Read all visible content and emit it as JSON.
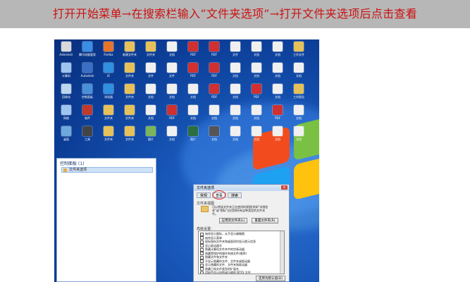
{
  "banner": {
    "text": "打开开始菜单→在搜索栏输入“文件夹选项”→打开文件夹选项后点击查看"
  },
  "desktop": {
    "icons": [
      {
        "label": "Administr",
        "color": "#d9d9d9"
      },
      {
        "label": "腾讯电脑管家",
        "color": "#3a8ee6"
      },
      {
        "label": "Firefox",
        "color": "#e8742b"
      },
      {
        "label": "新建文件夹",
        "color": "#e6c15a"
      },
      {
        "label": "文件夹",
        "color": "#e6c15a"
      },
      {
        "label": "文档",
        "color": "#f0f0f0"
      },
      {
        "label": "PDF",
        "color": "#d03030"
      },
      {
        "label": "PDF",
        "color": "#d03030"
      },
      {
        "label": "文件",
        "color": "#f0f0f0"
      },
      {
        "label": "文档",
        "color": "#f0f0f0"
      },
      {
        "label": "文档",
        "color": "#f0f0f0"
      },
      {
        "label": "工作文件",
        "color": "#e6c15a"
      },
      {
        "label": "计算机",
        "color": "#9fc5ef"
      },
      {
        "label": "Autodesk",
        "color": "#3a6fc4"
      },
      {
        "label": "IE",
        "color": "#2f8fe0"
      },
      {
        "label": "文件夹",
        "color": "#e6c15a"
      },
      {
        "label": "文件",
        "color": "#f0f0f0"
      },
      {
        "label": "文件",
        "color": "#f0f0f0"
      },
      {
        "label": "PDF",
        "color": "#d03030"
      },
      {
        "label": "PDF",
        "color": "#d03030"
      },
      {
        "label": "文档",
        "color": "#f0f0f0"
      },
      {
        "label": "文档",
        "color": "#f0f0f0"
      },
      {
        "label": "文档",
        "color": "#f0f0f0"
      },
      {
        "label": "文档",
        "color": "#f0f0f0"
      },
      {
        "label": "回收站",
        "color": "#bcd6f0"
      },
      {
        "label": "控制面板",
        "color": "#4a90d9"
      },
      {
        "label": "浏览器",
        "color": "#2f8fe0"
      },
      {
        "label": "文件夹",
        "color": "#e6c15a"
      },
      {
        "label": "文档",
        "color": "#f0f0f0"
      },
      {
        "label": "文档",
        "color": "#f0f0f0"
      },
      {
        "label": "文档",
        "color": "#f0f0f0"
      },
      {
        "label": "PDF",
        "color": "#d03030"
      },
      {
        "label": "文档",
        "color": "#f0f0f0"
      },
      {
        "label": "PDF",
        "color": "#d03030"
      },
      {
        "label": "文档",
        "color": "#f0f0f0"
      },
      {
        "label": "工作报告",
        "color": "#e6c15a"
      },
      {
        "label": "网络",
        "color": "#9fc5ef"
      },
      {
        "label": "软件",
        "color": "#c0392b"
      },
      {
        "label": "文件夹",
        "color": "#e6c15a"
      },
      {
        "label": "文件夹",
        "color": "#e6c15a"
      },
      {
        "label": "文档",
        "color": "#f0f0f0"
      },
      {
        "label": "PDF",
        "color": "#d03030"
      },
      {
        "label": "文档",
        "color": "#f0f0f0"
      },
      {
        "label": "文档",
        "color": "#f0f0f0"
      },
      {
        "label": "文档",
        "color": "#f0f0f0"
      },
      {
        "label": "文档",
        "color": "#f0f0f0"
      },
      {
        "label": "PDF",
        "color": "#d03030"
      },
      {
        "label": "文档",
        "color": "#f0f0f0"
      },
      {
        "label": "桌面",
        "color": "#6fa8dc"
      },
      {
        "label": "工具",
        "color": "#444444"
      },
      {
        "label": "文件夹",
        "color": "#e6c15a"
      },
      {
        "label": "文件夹",
        "color": "#e6c15a"
      },
      {
        "label": "图片",
        "color": "#7ab55c"
      },
      {
        "label": "文档",
        "color": "#f0f0f0"
      },
      {
        "label": "图片",
        "color": "#2b6e3f"
      },
      {
        "label": "文档",
        "color": "#555555"
      },
      {
        "label": "文档",
        "color": "#f0f0f0"
      },
      {
        "label": "文档",
        "color": "#f0f0f0"
      },
      {
        "label": "文档",
        "color": "#f0f0f0"
      },
      {
        "label": "文档",
        "color": "#f0f0f0"
      }
    ]
  },
  "control_panel": {
    "title": "控制面板 (1)",
    "item": "文件夹选项"
  },
  "folder_options": {
    "title": "文件夹选项",
    "close": "x",
    "tabs": [
      "常规",
      "查看",
      "搜索"
    ],
    "group": "文件夹视图",
    "desc": "可以将该文件夹正在使用的视图(例如\"详细信息\"或\"图标\")应用到所有这种类型的文件夹中。",
    "apply_button": "应用到文件夹(L)",
    "reset_button": "重置文件夹(R)",
    "advanced_label": "高级设置:",
    "advanced_rows": [
      "始终显示图标，从不显示缩略图",
      "始终显示菜单",
      "鼠标指向文件夹和桌面项时显示提示信息",
      "显示驱动器号",
      "隐藏计算机文件夹中的空驱动器",
      "隐藏受保护的操作系统文件(推荐)",
      "隐藏文件和文件夹",
      "不显示隐藏的文件、文件夹或驱动器",
      "显示隐藏的文件、文件夹和驱动器",
      "隐藏已知文件类型的扩展名",
      "用彩色显示加密或压缩的 NTFS 文件"
    ],
    "restore_button": "还原为默认值(D)"
  }
}
